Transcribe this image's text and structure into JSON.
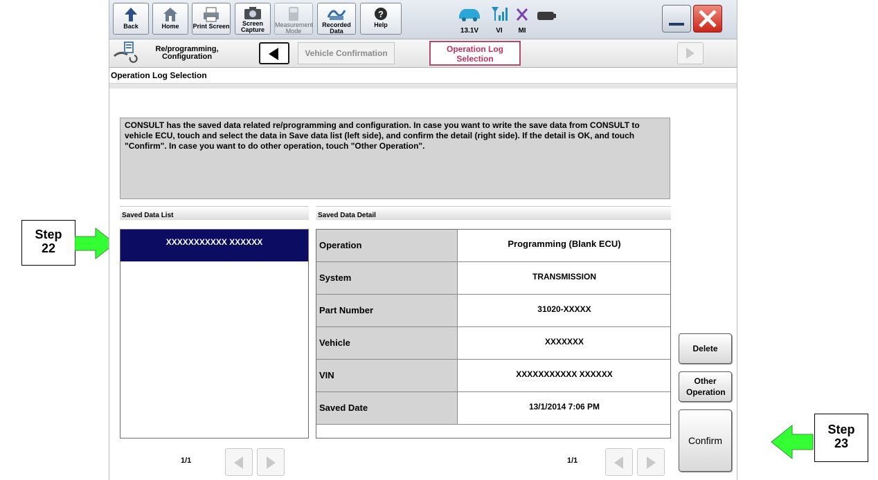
{
  "toolbar": {
    "back_label": "Back",
    "home_label": "Home",
    "print_label": "Print Screen",
    "capture_label": "Screen Capture",
    "measurement_label": "Measurement Mode",
    "recorded_label": "Recorded Data",
    "help_label": "Help",
    "voltage": "13.1V",
    "vi_label": "VI",
    "mi_label": "MI"
  },
  "breadcrumb": {
    "home_label": "Re/programming, Configuration",
    "step1_label": "Vehicle Confirmation",
    "step2_label": "Operation Log Selection"
  },
  "page_title": "Operation Log Selection",
  "message": "CONSULT has the saved data related re/programming and configuration. In case you want to write the save data from CONSULT to vehicle ECU, touch and select the data in Save data list (left side), and confirm the detail (right side). If the detail is OK, and touch \"Confirm\". In case you want to do other operation, touch \"Other Operation\".",
  "saved_list": {
    "header": "Saved Data List",
    "items": [
      "XXXXXXXXXXX XXXXXX"
    ],
    "page": "1/1"
  },
  "detail": {
    "header": "Saved Data Detail",
    "rows": [
      {
        "label": "Operation",
        "value": "Programming (Blank ECU)"
      },
      {
        "label": "System",
        "value": "TRANSMISSION"
      },
      {
        "label": "Part Number",
        "value": "31020-XXXXX"
      },
      {
        "label": "Vehicle",
        "value": "XXXXXXX"
      },
      {
        "label": "VIN",
        "value": "XXXXXXXXXXX XXXXXX"
      },
      {
        "label": "Saved Date",
        "value": "13/1/2014 7:06 PM"
      }
    ],
    "page": "1/1"
  },
  "buttons": {
    "delete": "Delete",
    "other_operation": "Other Operation",
    "confirm": "Confirm"
  },
  "callouts": {
    "step22_word": "Step",
    "step22_num": "22",
    "step23_word": "Step",
    "step23_num": "23"
  },
  "colors": {
    "selection": "#0c0c62",
    "active_step": "#c0305a",
    "callout_arrow": "#33ff33",
    "close_button": "#c9271a"
  }
}
